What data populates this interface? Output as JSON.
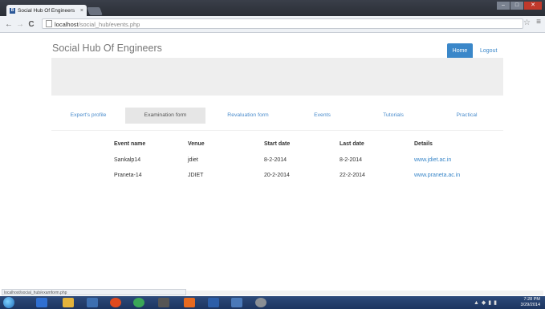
{
  "browser": {
    "tab_title": "Social Hub Of Engineers",
    "tab_close": "×",
    "favicon_letter": "B",
    "url_host": "localhost",
    "url_path": "/social_hub/events.php",
    "back": "←",
    "forward": "→",
    "reload": "C",
    "star": "☆",
    "menu": "≡",
    "status_text": "localhost/social_hub/examform.php"
  },
  "page": {
    "brand": "Social Hub Of Engineers",
    "home_label": "Home",
    "logout_label": "Logout",
    "tabs": [
      {
        "label": "Expert's profile"
      },
      {
        "label": "Examination form"
      },
      {
        "label": "Revaluation form"
      },
      {
        "label": "Events"
      },
      {
        "label": "Tutorials"
      },
      {
        "label": "Practical"
      }
    ],
    "table": {
      "headers": [
        "Event name",
        "Venue",
        "Start date",
        "Last date",
        "Details"
      ],
      "rows": [
        [
          "Sankalp14",
          "jdiet",
          "8-2-2014",
          "8-2-2014",
          "www.jdiet.ac.in"
        ],
        [
          "Praneta-14",
          "JDIET",
          "20-2-2014",
          "22-2-2014",
          "www.praneta.ac.in"
        ]
      ]
    }
  },
  "taskbar": {
    "time": "7:28 PM",
    "date": "3/29/2014"
  },
  "colors": {
    "accent": "#3a87c9",
    "jumbotron": "#eeeeee",
    "active_tab": "#e6e6e6"
  }
}
